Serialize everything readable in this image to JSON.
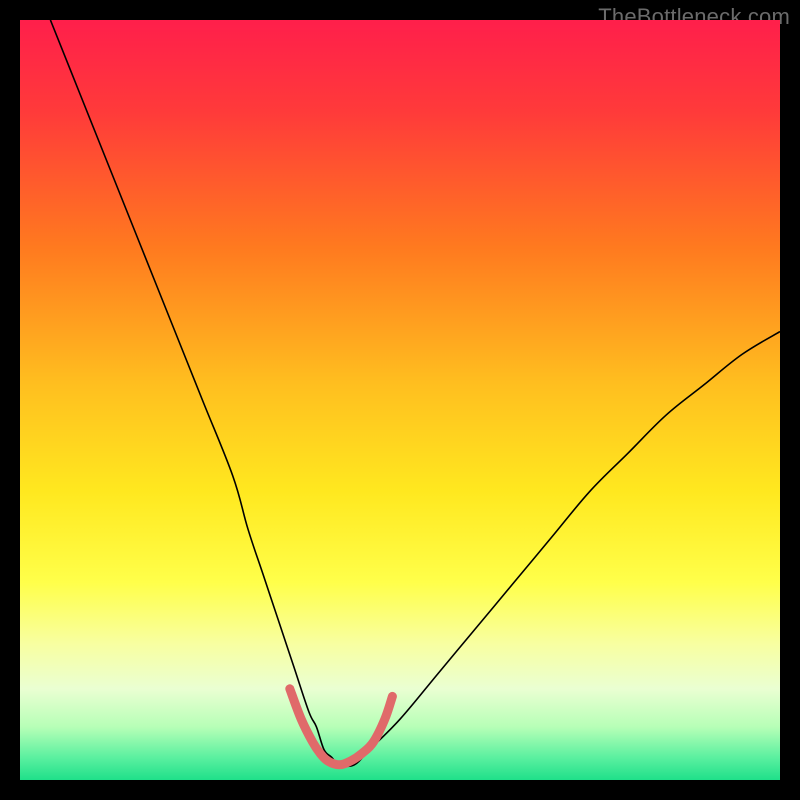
{
  "watermark": "TheBottleneck.com",
  "chart_data": {
    "type": "line",
    "title": "",
    "xlabel": "",
    "ylabel": "",
    "xlim": [
      0,
      100
    ],
    "ylim": [
      0,
      100
    ],
    "grid": false,
    "legend": false,
    "background_gradient_stops": [
      {
        "offset": 0.0,
        "color": "#ff1f4b"
      },
      {
        "offset": 0.12,
        "color": "#ff3a3a"
      },
      {
        "offset": 0.3,
        "color": "#ff7a1f"
      },
      {
        "offset": 0.48,
        "color": "#ffbf1f"
      },
      {
        "offset": 0.62,
        "color": "#ffe81f"
      },
      {
        "offset": 0.74,
        "color": "#ffff4a"
      },
      {
        "offset": 0.82,
        "color": "#f8ffa0"
      },
      {
        "offset": 0.88,
        "color": "#eaffd2"
      },
      {
        "offset": 0.93,
        "color": "#b7ffb7"
      },
      {
        "offset": 0.97,
        "color": "#5cf0a0"
      },
      {
        "offset": 1.0,
        "color": "#1fe08a"
      }
    ],
    "series": [
      {
        "name": "bottleneck-curve",
        "stroke": "#000000",
        "stroke_width": 1.6,
        "x": [
          4,
          8,
          12,
          16,
          20,
          24,
          28,
          30,
          32,
          34,
          36,
          38,
          39,
          40,
          41,
          42,
          44,
          46,
          50,
          55,
          60,
          65,
          70,
          75,
          80,
          85,
          90,
          95,
          100
        ],
        "y": [
          100,
          90,
          80,
          70,
          60,
          50,
          40,
          33,
          27,
          21,
          15,
          9,
          7,
          4,
          3,
          2,
          2,
          4,
          8,
          14,
          20,
          26,
          32,
          38,
          43,
          48,
          52,
          56,
          59
        ]
      },
      {
        "name": "optimal-zone-highlight",
        "stroke": "#e06a6a",
        "stroke_width": 9,
        "linecap": "round",
        "x": [
          35.5,
          37,
          38.5,
          39.5,
          40.5,
          42,
          43.5,
          45,
          46.5,
          48,
          49
        ],
        "y": [
          12,
          8,
          5,
          3.5,
          2.5,
          2,
          2.5,
          3.5,
          5,
          8,
          11
        ]
      }
    ]
  }
}
